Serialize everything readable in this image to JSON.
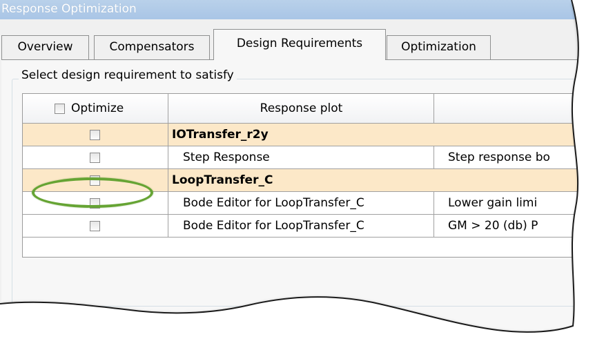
{
  "window": {
    "title": "Response Optimization"
  },
  "tabs": [
    {
      "label": "Overview"
    },
    {
      "label": "Compensators"
    },
    {
      "label": "Design Requirements",
      "active": true
    },
    {
      "label": "Optimization"
    }
  ],
  "group": {
    "title": "Select design requirement to satisfy"
  },
  "table": {
    "columns": [
      {
        "label": "Optimize",
        "has_checkbox": true,
        "checked": false
      },
      {
        "label": "Response plot"
      },
      {
        "label": ""
      }
    ],
    "rows": [
      {
        "type": "group",
        "checked": false,
        "name": "IOTransfer_r2y",
        "requirement": ""
      },
      {
        "type": "item",
        "checked": false,
        "name": "Step Response",
        "requirement": "Step response bo"
      },
      {
        "type": "group",
        "checked": false,
        "name": "LoopTransfer_C",
        "requirement": "",
        "highlighted": true
      },
      {
        "type": "item",
        "checked": false,
        "name": "Bode Editor for LoopTransfer_C",
        "requirement": "Lower gain limi"
      },
      {
        "type": "item",
        "checked": false,
        "name": "Bode Editor for LoopTransfer_C",
        "requirement": "GM > 20 (db)  P"
      }
    ]
  },
  "colors": {
    "title_bar": "#a9c5e6",
    "group_row": "#fce8c8",
    "highlight_ellipse": "#66a434"
  }
}
